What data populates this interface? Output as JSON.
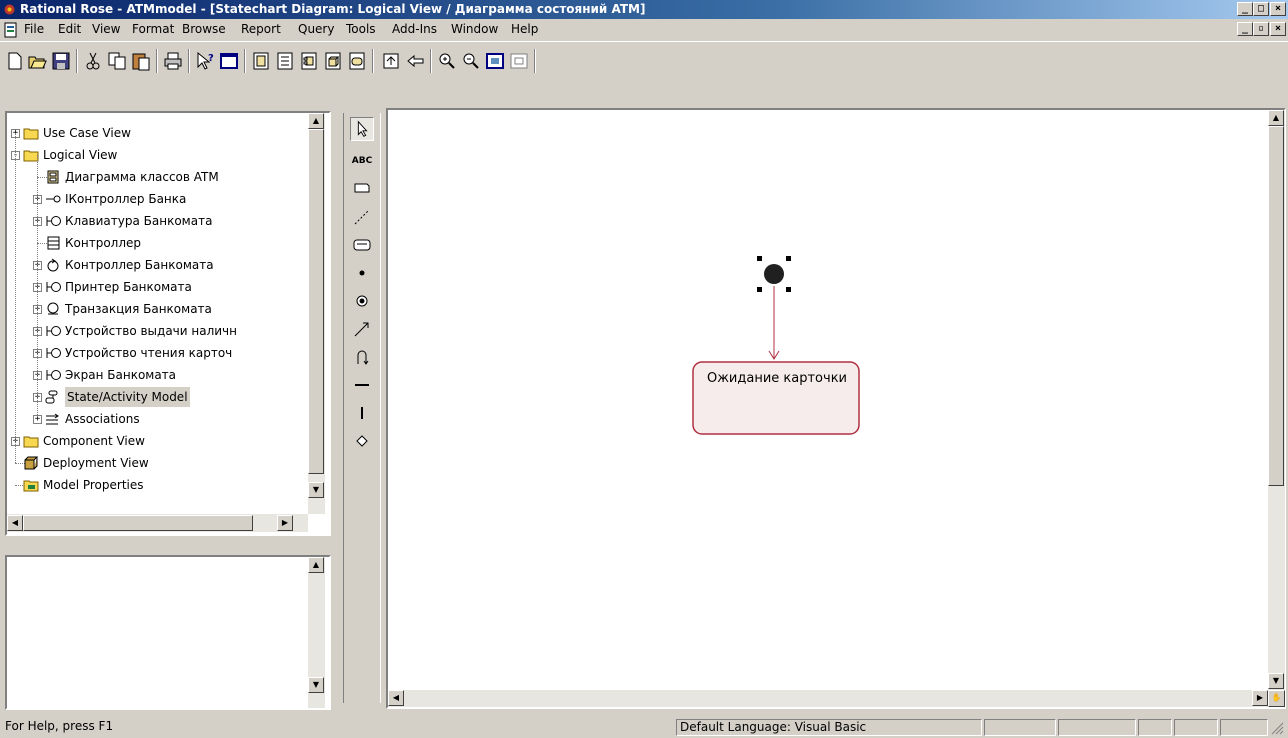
{
  "window": {
    "title": "Rational Rose - ATMmodel - [Statechart Diagram: Logical View / Диаграмма состояний ATM]",
    "minimize": "_",
    "maximize": "□",
    "close": "×"
  },
  "menu": [
    "File",
    "Edit",
    "View",
    "Format",
    "Browse",
    "Report",
    "Query",
    "Tools",
    "Add-Ins",
    "Window",
    "Help"
  ],
  "mdi_controls": {
    "minimize": "_",
    "restore": "▫",
    "close": "×"
  },
  "toolbar": {
    "buttons": [
      "new-icon",
      "open-icon",
      "save-icon",
      "cut-icon",
      "copy-icon",
      "paste-icon",
      "print-icon",
      "context-help-icon",
      "view-doc-icon",
      "browse-class-diagram-icon",
      "browse-interaction-diagram-icon",
      "browse-component-diagram-icon",
      "browse-deployment-diagram-icon",
      "browse-state-diagram-icon",
      "browse-parent-icon",
      "browse-previous-icon",
      "zoom-in-icon",
      "zoom-out-icon",
      "fit-in-window-icon",
      "undo-fit-icon"
    ]
  },
  "tree": {
    "items": [
      {
        "label": "Use Case View"
      },
      {
        "label": "Logical View"
      },
      {
        "label": "Диаграмма классов ATM"
      },
      {
        "label": "IКонтроллер Банка"
      },
      {
        "label": "Клавиатура Банкомата"
      },
      {
        "label": "Контроллер"
      },
      {
        "label": "Контроллер Банкомата"
      },
      {
        "label": "Принтер Банкомата"
      },
      {
        "label": "Транзакция Банкомата"
      },
      {
        "label": "Устройство выдачи наличн"
      },
      {
        "label": "Устройство чтения карточ"
      },
      {
        "label": "Экран Банкомата"
      },
      {
        "label": "State/Activity Model"
      },
      {
        "label": "Associations"
      },
      {
        "label": "Component View"
      },
      {
        "label": "Deployment View"
      },
      {
        "label": "Model Properties"
      }
    ]
  },
  "palette": {
    "tools": [
      "selection-arrow-icon",
      "text-box-icon",
      "note-icon",
      "anchor-note-icon",
      "state-icon",
      "start-state-icon",
      "end-state-icon",
      "state-transition-icon",
      "transition-to-self-icon",
      "horizontal-sync-icon",
      "vertical-sync-icon",
      "decision-icon"
    ],
    "text_tool_label": "ABC"
  },
  "diagram": {
    "state_label": "Ожидание карточки"
  },
  "status": {
    "help": "For Help, press F1",
    "language": "Default Language: Visual Basic"
  },
  "colors": {
    "title_start": "#0a246a",
    "title_end": "#a6caf0",
    "state_fill": "#f7ecec",
    "state_border": "#b03040",
    "transition": "#b03040"
  }
}
